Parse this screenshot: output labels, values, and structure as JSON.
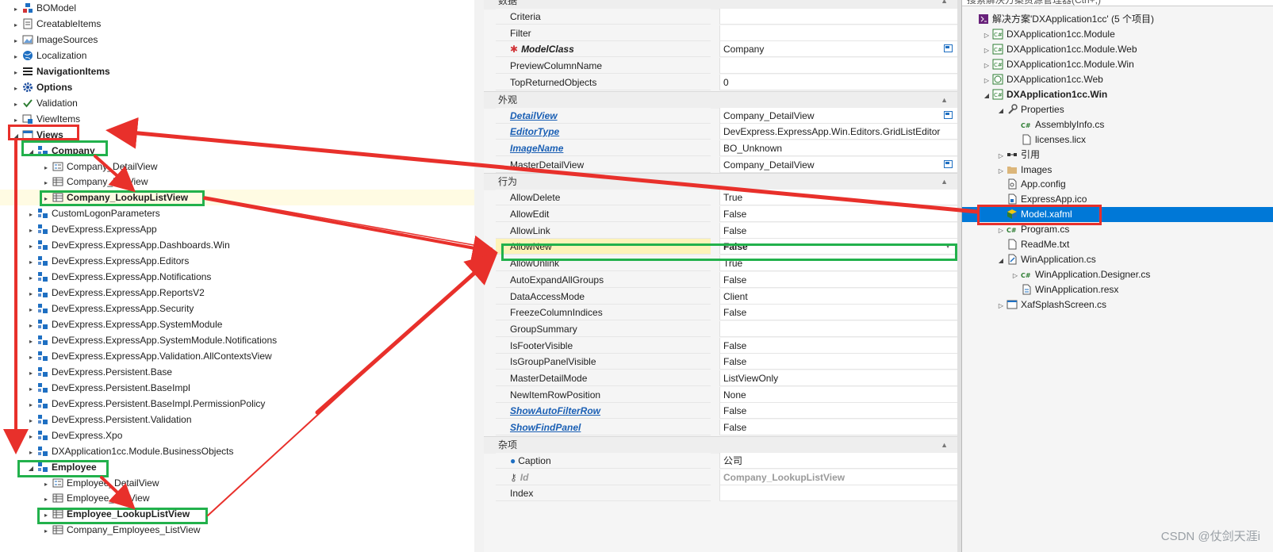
{
  "model_tree": [
    {
      "label": "BOModel",
      "icon": "bomodel-icon",
      "indent": 0,
      "caret": "right",
      "bold": false
    },
    {
      "label": "CreatableItems",
      "icon": "document-icon",
      "indent": 0,
      "caret": "right",
      "bold": false
    },
    {
      "label": "ImageSources",
      "icon": "image-icon",
      "indent": 0,
      "caret": "right",
      "bold": false
    },
    {
      "label": "Localization",
      "icon": "globe-icon",
      "indent": 0,
      "caret": "right",
      "bold": false
    },
    {
      "label": "NavigationItems",
      "icon": "navigation-icon",
      "indent": 0,
      "caret": "right",
      "bold": true
    },
    {
      "label": "Options",
      "icon": "gear-icon",
      "indent": 0,
      "caret": "right",
      "bold": true
    },
    {
      "label": "Validation",
      "icon": "checkmark-icon",
      "indent": 0,
      "caret": "right",
      "bold": false
    },
    {
      "label": "ViewItems",
      "icon": "viewitems-icon",
      "indent": 0,
      "caret": "right",
      "bold": false
    },
    {
      "label": "Views",
      "icon": "views-icon",
      "indent": 0,
      "caret": "down",
      "bold": true
    },
    {
      "label": "Company",
      "icon": "class-icon",
      "indent": 1,
      "caret": "down",
      "bold": true
    },
    {
      "label": "Company_DetailView",
      "icon": "detailview-icon",
      "indent": 2,
      "caret": "right",
      "bold": false
    },
    {
      "label": "Company_ListView",
      "icon": "listview-icon",
      "indent": 2,
      "caret": "right",
      "bold": false
    },
    {
      "label": "Company_LookupListView",
      "icon": "listview-icon",
      "indent": 2,
      "caret": "right",
      "bold": true,
      "selected": true
    },
    {
      "label": "CustomLogonParameters",
      "icon": "class-icon",
      "indent": 1,
      "caret": "right",
      "bold": false
    },
    {
      "label": "DevExpress.ExpressApp",
      "icon": "class-icon",
      "indent": 1,
      "caret": "right",
      "bold": false
    },
    {
      "label": "DevExpress.ExpressApp.Dashboards.Win",
      "icon": "class-icon",
      "indent": 1,
      "caret": "right",
      "bold": false
    },
    {
      "label": "DevExpress.ExpressApp.Editors",
      "icon": "class-icon",
      "indent": 1,
      "caret": "right",
      "bold": false
    },
    {
      "label": "DevExpress.ExpressApp.Notifications",
      "icon": "class-icon",
      "indent": 1,
      "caret": "right",
      "bold": false
    },
    {
      "label": "DevExpress.ExpressApp.ReportsV2",
      "icon": "class-icon",
      "indent": 1,
      "caret": "right",
      "bold": false
    },
    {
      "label": "DevExpress.ExpressApp.Security",
      "icon": "class-icon",
      "indent": 1,
      "caret": "right",
      "bold": false
    },
    {
      "label": "DevExpress.ExpressApp.SystemModule",
      "icon": "class-icon",
      "indent": 1,
      "caret": "right",
      "bold": false
    },
    {
      "label": "DevExpress.ExpressApp.SystemModule.Notifications",
      "icon": "class-icon",
      "indent": 1,
      "caret": "right",
      "bold": false
    },
    {
      "label": "DevExpress.ExpressApp.Validation.AllContextsView",
      "icon": "class-icon",
      "indent": 1,
      "caret": "right",
      "bold": false
    },
    {
      "label": "DevExpress.Persistent.Base",
      "icon": "class-icon",
      "indent": 1,
      "caret": "right",
      "bold": false
    },
    {
      "label": "DevExpress.Persistent.BaseImpl",
      "icon": "class-icon",
      "indent": 1,
      "caret": "right",
      "bold": false
    },
    {
      "label": "DevExpress.Persistent.BaseImpl.PermissionPolicy",
      "icon": "class-icon",
      "indent": 1,
      "caret": "right",
      "bold": false
    },
    {
      "label": "DevExpress.Persistent.Validation",
      "icon": "class-icon",
      "indent": 1,
      "caret": "right",
      "bold": false
    },
    {
      "label": "DevExpress.Xpo",
      "icon": "class-icon",
      "indent": 1,
      "caret": "right",
      "bold": false
    },
    {
      "label": "DXApplication1cc.Module.BusinessObjects",
      "icon": "class-icon",
      "indent": 1,
      "caret": "right",
      "bold": false
    },
    {
      "label": "Employee",
      "icon": "class-icon",
      "indent": 1,
      "caret": "down",
      "bold": true
    },
    {
      "label": "Employee_DetailView",
      "icon": "detailview-icon",
      "indent": 2,
      "caret": "right",
      "bold": false
    },
    {
      "label": "Employee_ListView",
      "icon": "listview-icon",
      "indent": 2,
      "caret": "right",
      "bold": false
    },
    {
      "label": "Employee_LookupListView",
      "icon": "listview-icon",
      "indent": 2,
      "caret": "right",
      "bold": true
    },
    {
      "label": "Company_Employees_ListView",
      "icon": "listview-icon",
      "indent": 2,
      "caret": "right",
      "bold": false
    }
  ],
  "property_grid": {
    "groups": [
      {
        "title": "数据",
        "rows": [
          {
            "name": "Criteria",
            "value": "",
            "style": ""
          },
          {
            "name": "Filter",
            "value": "",
            "style": ""
          },
          {
            "name": "ModelClass",
            "value": "Company",
            "style": "required",
            "button": "edit"
          },
          {
            "name": "PreviewColumnName",
            "value": "",
            "style": ""
          },
          {
            "name": "TopReturnedObjects",
            "value": "0",
            "style": ""
          }
        ]
      },
      {
        "title": "外观",
        "rows": [
          {
            "name": "DetailView",
            "value": "Company_DetailView",
            "style": "link",
            "button": "edit"
          },
          {
            "name": "EditorType",
            "value": "DevExpress.ExpressApp.Win.Editors.GridListEditor",
            "style": "link"
          },
          {
            "name": "ImageName",
            "value": "BO_Unknown",
            "style": "link"
          },
          {
            "name": "MasterDetailView",
            "value": "Company_DetailView",
            "style": "",
            "button": "edit"
          }
        ]
      },
      {
        "title": "行为",
        "rows": [
          {
            "name": "AllowDelete",
            "value": "True",
            "style": ""
          },
          {
            "name": "AllowEdit",
            "value": "False",
            "style": ""
          },
          {
            "name": "AllowLink",
            "value": "False",
            "style": ""
          },
          {
            "name": "AllowNew",
            "value": "False",
            "style": "highlight",
            "button": "dropdown"
          },
          {
            "name": "AllowUnlink",
            "value": "True",
            "style": ""
          },
          {
            "name": "AutoExpandAllGroups",
            "value": "False",
            "style": ""
          },
          {
            "name": "DataAccessMode",
            "value": "Client",
            "style": ""
          },
          {
            "name": "FreezeColumnIndices",
            "value": "False",
            "style": ""
          },
          {
            "name": "GroupSummary",
            "value": "",
            "style": ""
          },
          {
            "name": "IsFooterVisible",
            "value": "False",
            "style": ""
          },
          {
            "name": "IsGroupPanelVisible",
            "value": "False",
            "style": ""
          },
          {
            "name": "MasterDetailMode",
            "value": "ListViewOnly",
            "style": ""
          },
          {
            "name": "NewItemRowPosition",
            "value": "None",
            "style": ""
          },
          {
            "name": "ShowAutoFilterRow",
            "value": "False",
            "style": "link"
          },
          {
            "name": "ShowFindPanel",
            "value": "False",
            "style": "link"
          }
        ]
      },
      {
        "title": "杂项",
        "rows": [
          {
            "name": "Caption",
            "value": "公司",
            "style": "globe"
          },
          {
            "name": "Id",
            "value": "Company_LookupListView",
            "style": "key"
          },
          {
            "name": "Index",
            "value": "",
            "style": ""
          }
        ]
      }
    ]
  },
  "solution_explorer": {
    "search_placeholder": "搜索解决方案资源管理器(Ctrl+;)",
    "items": [
      {
        "label": "解决方案'DXApplication1cc' (5 个项目)",
        "icon": "solution-icon",
        "indent": 0,
        "caret": "",
        "bold": false
      },
      {
        "label": "DXApplication1cc.Module",
        "icon": "csproj-icon",
        "indent": 1,
        "caret": "right",
        "bold": false
      },
      {
        "label": "DXApplication1cc.Module.Web",
        "icon": "csproj-icon",
        "indent": 1,
        "caret": "right",
        "bold": false
      },
      {
        "label": "DXApplication1cc.Module.Win",
        "icon": "csproj-icon",
        "indent": 1,
        "caret": "right",
        "bold": false
      },
      {
        "label": "DXApplication1cc.Web",
        "icon": "webproj-icon",
        "indent": 1,
        "caret": "right",
        "bold": false
      },
      {
        "label": "DXApplication1cc.Win",
        "icon": "csproj-icon",
        "indent": 1,
        "caret": "down",
        "bold": true
      },
      {
        "label": "Properties",
        "icon": "wrench-icon",
        "indent": 2,
        "caret": "down",
        "bold": false
      },
      {
        "label": "AssemblyInfo.cs",
        "icon": "csfile-icon",
        "indent": 3,
        "caret": "",
        "bold": false
      },
      {
        "label": "licenses.licx",
        "icon": "file-icon",
        "indent": 3,
        "caret": "",
        "bold": false
      },
      {
        "label": "引用",
        "icon": "references-icon",
        "indent": 2,
        "caret": "right",
        "bold": false
      },
      {
        "label": "Images",
        "icon": "folder-icon",
        "indent": 2,
        "caret": "right",
        "bold": false
      },
      {
        "label": "App.config",
        "icon": "config-icon",
        "indent": 2,
        "caret": "",
        "bold": false
      },
      {
        "label": "ExpressApp.ico",
        "icon": "ico-file-icon",
        "indent": 2,
        "caret": "",
        "bold": false
      },
      {
        "label": "Model.xafml",
        "icon": "model-icon",
        "indent": 2,
        "caret": "",
        "bold": false,
        "selected": true
      },
      {
        "label": "Program.cs",
        "icon": "csfile-icon",
        "indent": 2,
        "caret": "right",
        "bold": false
      },
      {
        "label": "ReadMe.txt",
        "icon": "file-icon",
        "indent": 2,
        "caret": "",
        "bold": false
      },
      {
        "label": "WinApplication.cs",
        "icon": "designer-icon",
        "indent": 2,
        "caret": "down",
        "bold": false
      },
      {
        "label": "WinApplication.Designer.cs",
        "icon": "csfile-icon",
        "indent": 3,
        "caret": "right",
        "bold": false
      },
      {
        "label": "WinApplication.resx",
        "icon": "resx-icon",
        "indent": 3,
        "caret": "",
        "bold": false
      },
      {
        "label": "XafSplashScreen.cs",
        "icon": "form-icon",
        "indent": 2,
        "caret": "right",
        "bold": false
      }
    ]
  },
  "watermark": "CSDN @仗剑天涯i",
  "colors": {
    "annotation_red": "#e8302b",
    "annotation_green": "#22b14c",
    "selection_blue": "#0078d7",
    "link_blue": "#1a5fb4"
  }
}
